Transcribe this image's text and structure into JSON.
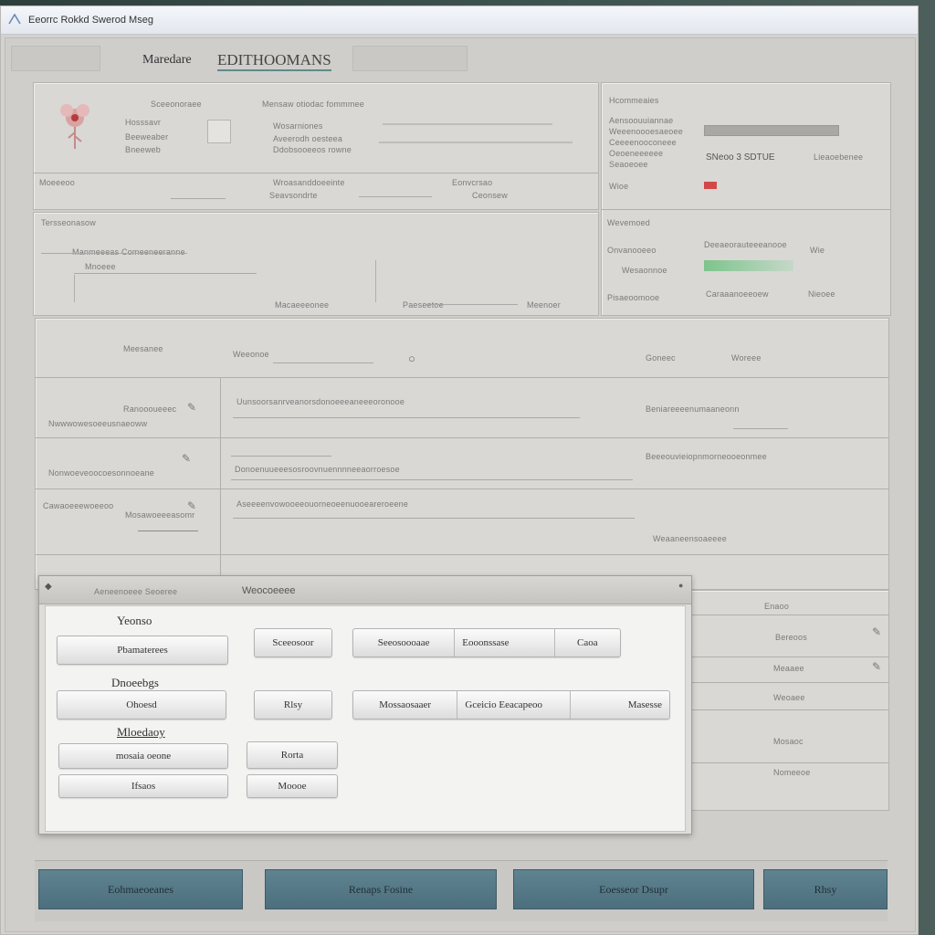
{
  "window": {
    "title": "Eeorrc Rokkd Swerod Mseg",
    "app_name": "Maredare",
    "app_tagline": "EDITHOOMANS"
  },
  "top_panel": {
    "header_items": [
      "Sceeonoraee",
      "Mensaw otiodac fommmee"
    ],
    "left_labels": [
      "Hosssavr",
      "Beeweaber",
      "Bneeweb"
    ],
    "mid_labels": [
      "Wosarniones",
      "Aveerodh oesteea",
      "Ddobsooeeos rowne"
    ],
    "row_labels": [
      "Moeeeoo",
      "Wroasanddoeeinte",
      "Eonvcrsao",
      "Seavsondrte",
      "Ceonsew"
    ]
  },
  "right_panel": {
    "title": "Hcommeaies",
    "lines": [
      "Aensoouuiannae",
      "Weeenoooesaeoee",
      "Ceeeenooconeee",
      "Oeoeneeeeee",
      "Seaoeoee",
      "Wioe"
    ],
    "status_label": "SNeoo 3 SDTUE",
    "status_value": "Lieaoebenee",
    "section2_title": "Wevemoed",
    "section2_items": [
      "Onvanooeeo",
      "Wesaonnoe",
      "Pisaeoomooe"
    ],
    "section2_values": [
      "Deeaeorauteeeanooe",
      "Wie",
      "Caraaanoeeoew",
      "Nieoee"
    ]
  },
  "mid_panel": {
    "title": "Tersseonasow",
    "line": "Manmeeeas Comeeneeranne",
    "label": "Mnoeee",
    "bottom_labels": [
      "Macaeeeonee",
      "Paeseetoe",
      "Meenoer"
    ]
  },
  "list_panel": {
    "header_labels": [
      "Meesanee",
      "Weeonoe",
      "Goneec",
      "Woreee"
    ],
    "rows": [
      {
        "label": "Ranoooueeec",
        "sub": "Nwwwowesoeeusnaeoww",
        "text": "Uunsoorsanrveanorsdonoeeeaneeeoronooe",
        "right": "Beniareeeenumaaneonn"
      },
      {
        "label": "Nonwoeveoocoesonnoeane",
        "sub": "",
        "text": "Donoenuueeesosroovnuennnneeaorroesoe",
        "right": "Beeeouvieiopnmorneooeonmee"
      },
      {
        "label": "Cawaoeeewoeeoo",
        "sub": "Mosawoeeeasomr",
        "text": "Aseeeenvowooeeouorneoeenuooeareroeene",
        "right": "Weaaneensoaeeee"
      }
    ],
    "side_rows": [
      "Enaoo",
      "Bereoos",
      "Meaaee",
      "Weoaee",
      "Mosaoc",
      "Nomeeoe"
    ]
  },
  "dialog": {
    "title": "Aeneenoeee Seoeree",
    "title2": "Weocoeeee",
    "group1_label": "Yeonso",
    "group1_button": "Pbamaterees",
    "group2_label": "Dnoeebgs",
    "group2_button": "Ohoesd",
    "group3_label": "Mloedaoy",
    "group3_button1": "mosaia oeone",
    "group3_button2": "Ifsaos",
    "col2_buttons": [
      "Sceeosoor",
      "Rlsy",
      "Rorta",
      "Moooe"
    ],
    "seg1": [
      "Seeosoooaae",
      "Eooonssase",
      "Caoa"
    ],
    "seg2": [
      "Mossaosaaer",
      "Gceicio Eeacapeoo",
      "Masesse"
    ]
  },
  "bottom_bar": {
    "buttons": [
      "Eohmaeoeanes",
      "Renaps Fosine",
      "Eoesseor Dsupr",
      "Rhsy"
    ]
  }
}
